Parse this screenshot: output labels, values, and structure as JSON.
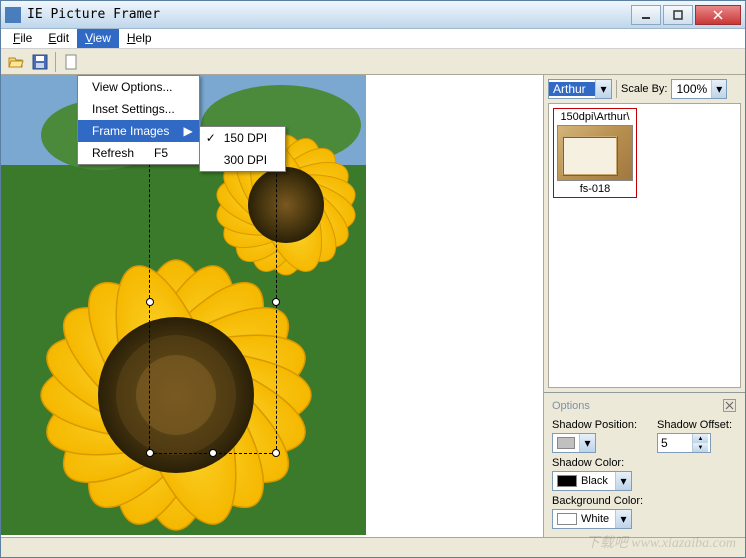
{
  "window": {
    "title": "IE Picture Framer"
  },
  "menubar": [
    "File",
    "Edit",
    "View",
    "Help"
  ],
  "view_menu": {
    "view_options": "View Options...",
    "inset_settings": "Inset Settings...",
    "frame_images": "Frame Images",
    "refresh": "Refresh",
    "refresh_shortcut": "F5"
  },
  "submenu": {
    "dpi150": "150 DPI",
    "dpi300": "300 DPI"
  },
  "right": {
    "frame_category": "Arthur",
    "scale_by_label": "Scale By:",
    "scale_by_value": "100%",
    "thumb_path": "150dpi\\Arthur\\",
    "thumb_name": "fs-018"
  },
  "options": {
    "title": "Options",
    "shadow_position_label": "Shadow Position:",
    "shadow_offset_label": "Shadow Offset:",
    "shadow_offset_value": "5",
    "shadow_color_label": "Shadow Color:",
    "shadow_color_value": "Black",
    "background_color_label": "Background Color:",
    "background_color_value": "White"
  },
  "colors": {
    "black": "#000000",
    "white": "#ffffff"
  },
  "watermark": "下载吧 www.xiazaiba.com"
}
